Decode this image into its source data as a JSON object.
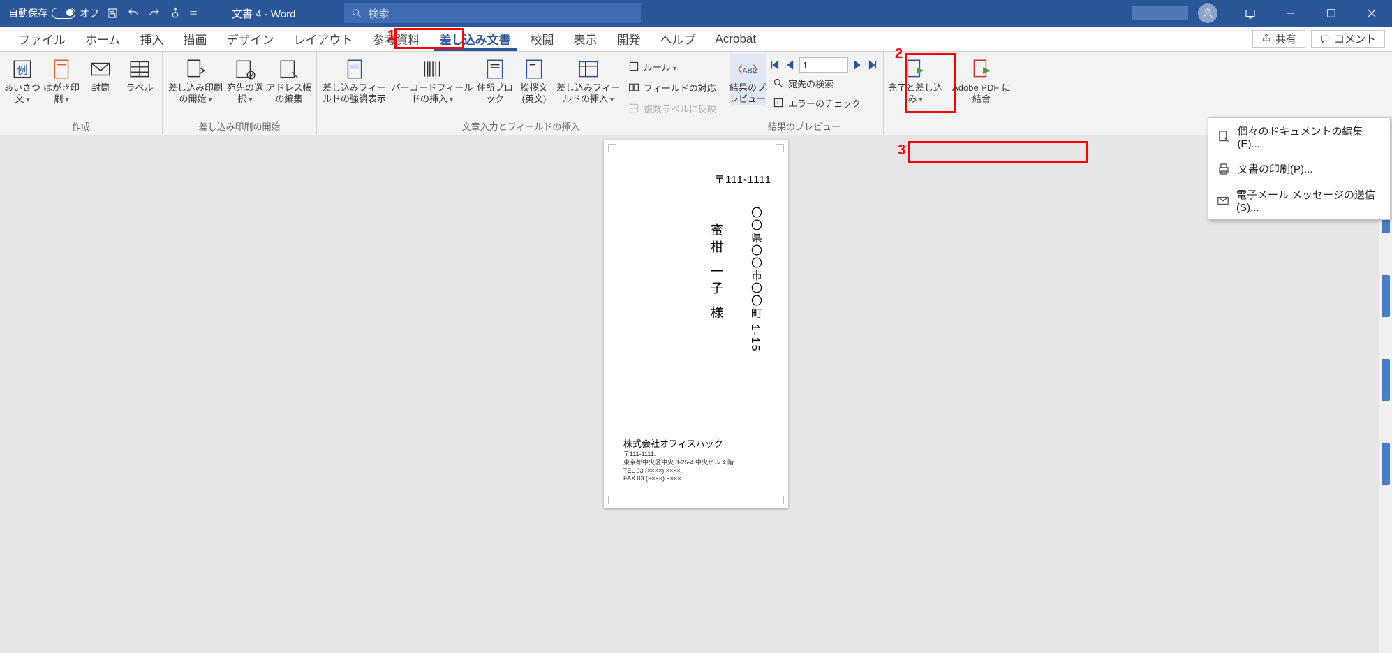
{
  "title": {
    "autosave_label": "自動保存",
    "autosave_state": "オフ",
    "doc_name": "文書 4  -  Word",
    "search_placeholder": "検索"
  },
  "tabs": {
    "file": "ファイル",
    "home": "ホーム",
    "insert": "挿入",
    "draw": "描画",
    "design": "デザイン",
    "layout": "レイアウト",
    "references": "参考資料",
    "mailings": "差し込み文書",
    "review": "校閲",
    "view": "表示",
    "developer": "開発",
    "help": "ヘルプ",
    "acrobat": "Acrobat",
    "share": "共有",
    "comment": "コメント"
  },
  "ribbon": {
    "g1": {
      "label": "作成",
      "greeting": "あいさつ文",
      "postcard": "はがき印刷",
      "envelope": "封筒",
      "labels": "ラベル"
    },
    "g2": {
      "label": "差し込み印刷の開始",
      "start": "差し込み印刷の開始",
      "recipients": "宛先の選択",
      "addrbook": "アドレス帳の編集"
    },
    "g3": {
      "label": "文章入力とフィールドの挿入",
      "highlight": "差し込みフィールドの強調表示",
      "barcode": "バーコードフィールドの挿入",
      "addrblock": "住所ブロック",
      "greetline": "挨拶文(英文)",
      "insertfield": "差し込みフィールドの挿入",
      "rules": "ルール",
      "match": "フィールドの対応",
      "updatelabels": "複数ラベルに反映"
    },
    "g4": {
      "label": "結果のプレビュー",
      "preview": "結果のプレビュー",
      "find": "宛先の検索",
      "errors": "エラーのチェック",
      "record": "1"
    },
    "g5": {
      "finish": "完了と差し込み",
      "pdf": "Adobe PDF に結合"
    }
  },
  "menu": {
    "edit_docs": "個々のドキュメントの編集(E)...",
    "print_docs": "文書の印刷(P)...",
    "email_docs": "電子メール メッセージの送信(S)..."
  },
  "doc": {
    "postal": "〒111-1111",
    "address": "〇〇県〇〇市〇〇町 1-15",
    "name": "蜜柑  一子  様",
    "sender_company": "株式会社オフィスハック",
    "sender_postal": "〒111-1111.",
    "sender_addr": "東京都中央区中央 3-25-4 中央ビル 4 階.",
    "sender_tel": "TEL 03 (××××) ××××.",
    "sender_fax": "FAX 03 (××××) ××××."
  },
  "anno": {
    "n1": "1",
    "n2": "2",
    "n3": "3"
  }
}
